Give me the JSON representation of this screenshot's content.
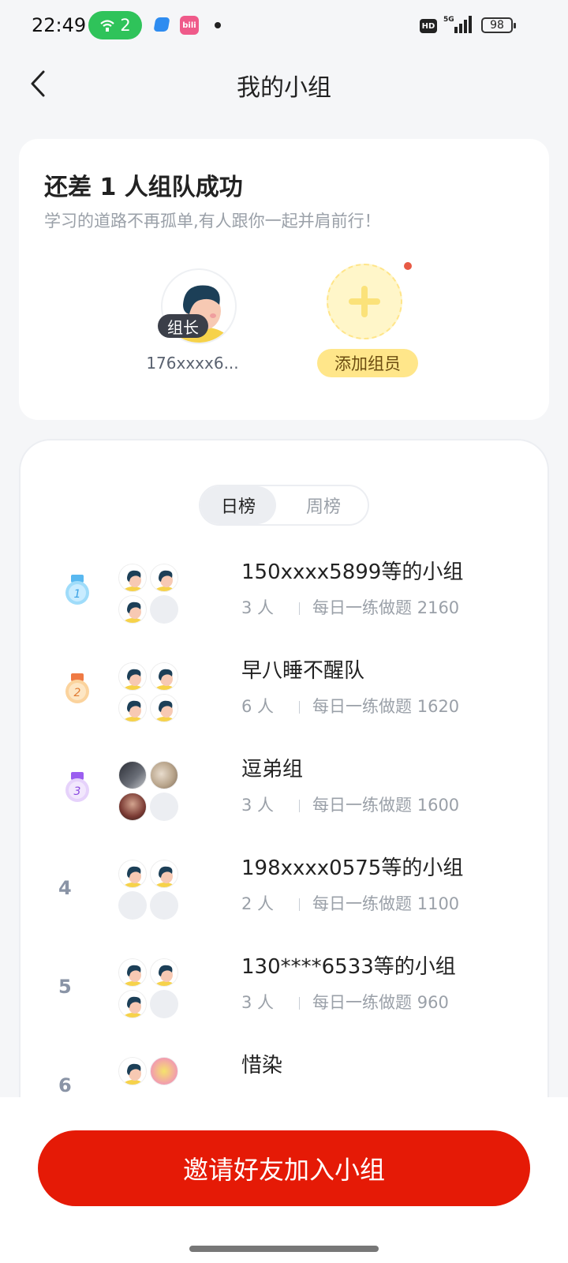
{
  "status_bar": {
    "time": "22:49",
    "wifi_count": "2",
    "app_badge": "bilibili",
    "hd": "HD",
    "battery": "98"
  },
  "header": {
    "title": "我的小组"
  },
  "team": {
    "title": "还差 1 人组队成功",
    "subtitle": "学习的道路不再孤单,有人跟你一起并肩前行！",
    "leader_badge": "组长",
    "leader_name": "176xxxx6...",
    "add_label": "添加组员"
  },
  "tabs": {
    "day": "日榜",
    "week": "周榜"
  },
  "ranking": [
    {
      "rank": "1",
      "name": "150xxxx5899等的小组",
      "people": "3 人",
      "score": "每日一练做题 2160"
    },
    {
      "rank": "2",
      "name": "早八睡不醒队",
      "people": "6 人",
      "score": "每日一练做题 1620"
    },
    {
      "rank": "3",
      "name": "逗弟组",
      "people": "3 人",
      "score": "每日一练做题 1600"
    },
    {
      "rank": "4",
      "name": "198xxxx0575等的小组",
      "people": "2 人",
      "score": "每日一练做题 1100"
    },
    {
      "rank": "5",
      "name": "130****6533等的小组",
      "people": "3 人",
      "score": "每日一练做题 960"
    },
    {
      "rank": "6",
      "name": "惜染",
      "people": "",
      "score": ""
    }
  ],
  "invite_button": "邀请好友加入小组"
}
